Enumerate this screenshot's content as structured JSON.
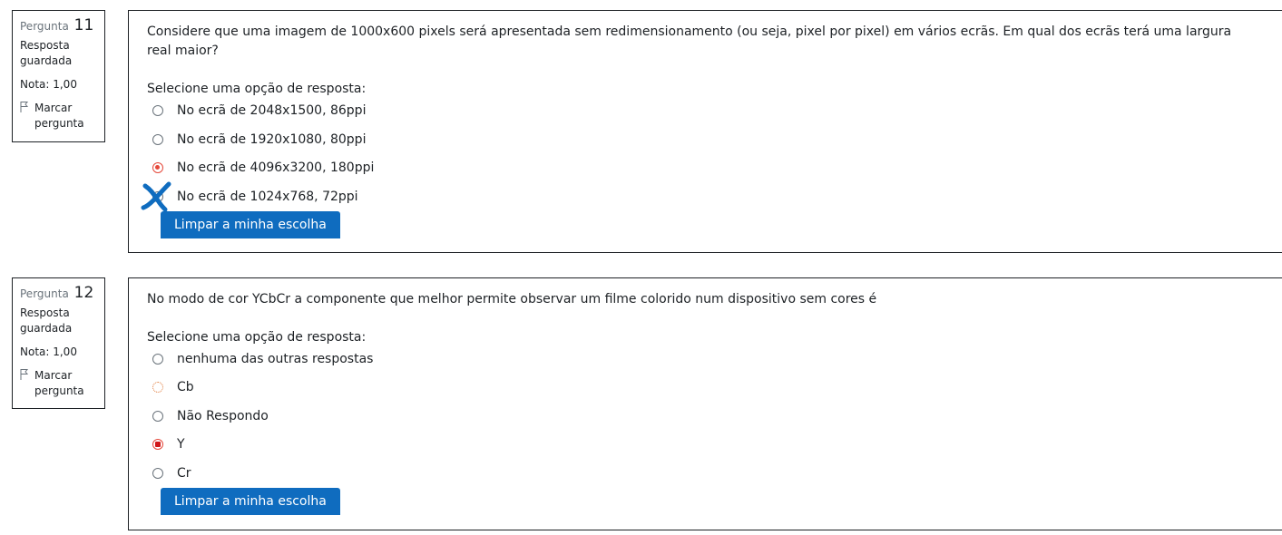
{
  "questions": [
    {
      "label": "Pergunta",
      "number": "11",
      "state": "Resposta guardada",
      "grade": "Nota: 1,00",
      "flag": "Marcar pergunta",
      "text": "Considere que uma imagem de 1000x600 pixels será apresentada sem redimensionamento (ou seja, pixel por pixel) em vários ecrãs. Em qual dos ecrãs terá uma largura real maior?",
      "prompt": "Selecione uma opção de resposta:",
      "options": [
        "No ecrã de 2048x1500, 86ppi",
        "No ecrã de 1920x1080, 80ppi",
        "No ecrã de 4096x3200, 180ppi",
        "No ecrã de 1024x768, 72ppi"
      ],
      "selected_option": "No ecrã de 4096x3200, 180ppi",
      "clear_button": "Limpar a minha escolha"
    },
    {
      "label": "Pergunta",
      "number": "12",
      "state": "Resposta guardada",
      "grade": "Nota: 1,00",
      "flag": "Marcar pergunta",
      "text": "No modo de cor YCbCr a componente que melhor permite observar um filme colorido num dispositivo sem cores é",
      "prompt": "Selecione uma opção de resposta:",
      "options": [
        "nenhuma das outras respostas",
        "Cb",
        "Não Respondo",
        "Y",
        "Cr"
      ],
      "selected_option": "Y",
      "clear_button": "Limpar a minha escolha"
    }
  ],
  "colors": {
    "button": "#0f6cbf",
    "selected_radio": "#e5483a",
    "annotation_mark": "#0f6cbf"
  }
}
